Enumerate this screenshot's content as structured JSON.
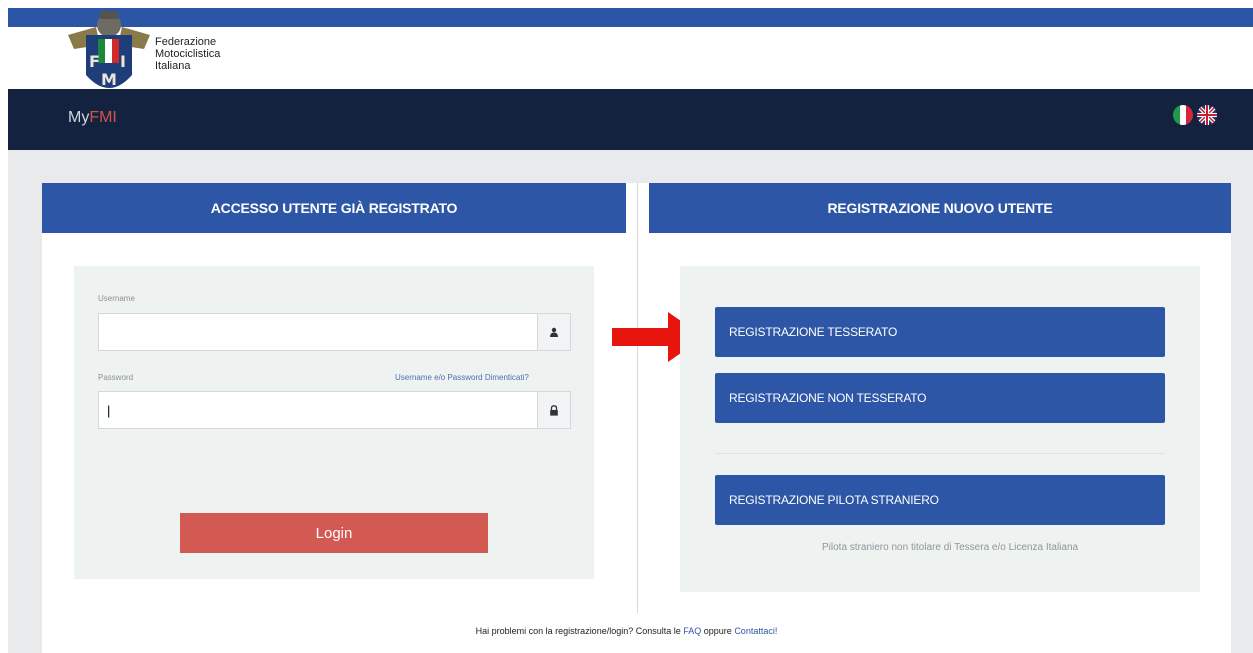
{
  "header": {
    "logo_lines": [
      "Federazione",
      "Motociclistica",
      "Italiana"
    ],
    "logo_icon": "fmi-logo-icon"
  },
  "navbar": {
    "brand_prefix": "My",
    "brand_accent": "FMI",
    "flag_it": "italian-flag-icon",
    "flag_en": "uk-flag-icon"
  },
  "login_panel": {
    "title": "ACCESSO UTENTE GIÀ REGISTRATO",
    "username_label": "Username",
    "username_value": "",
    "password_label": "Password",
    "password_value": "|",
    "forgot_link": "Username e/o Password Dimenticati?",
    "login_button": "Login"
  },
  "register_panel": {
    "title": "REGISTRAZIONE NUOVO UTENTE",
    "btn_tesserato": "REGISTRAZIONE TESSERATO",
    "btn_non_tesserato": "REGISTRAZIONE NON TESSERATO",
    "btn_pilota": "REGISTRAZIONE PILOTA STRANIERO",
    "pilota_note": "Pilota straniero non titolare di Tessera e/o Licenza Italiana"
  },
  "footer": {
    "text_before": "Hai problemi con la registrazione/login? Consulta le ",
    "faq_link": "FAQ",
    "text_middle": " oppure ",
    "contact_link": "Contattaci!"
  },
  "colors": {
    "primary_blue": "#2d56a6",
    "navbar_dark": "#13233f",
    "login_red": "#d25a52",
    "arrow_red": "#e8150f"
  }
}
